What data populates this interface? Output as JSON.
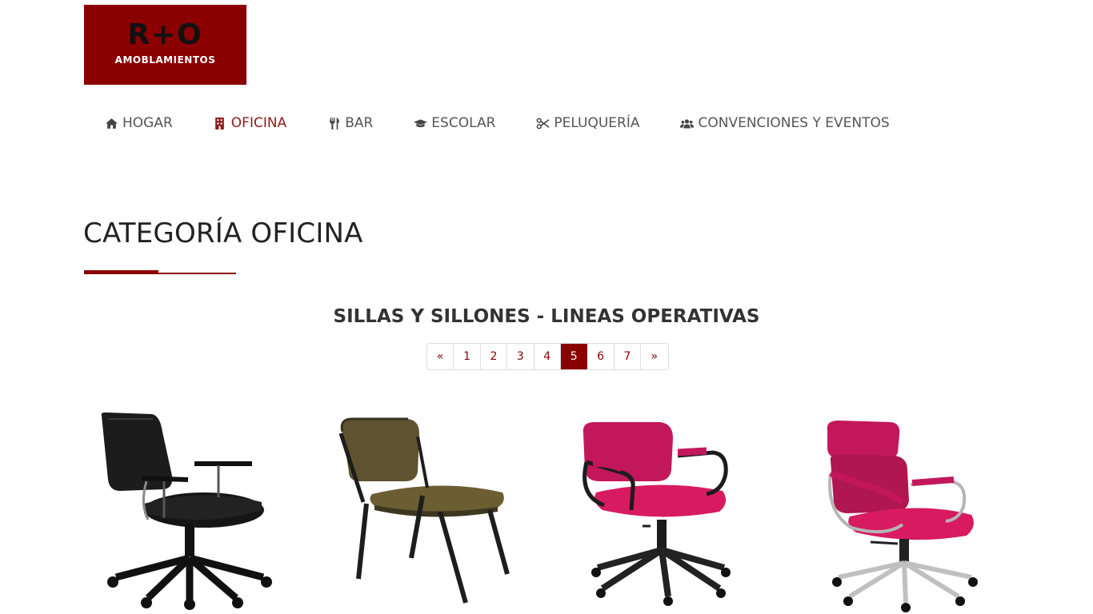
{
  "logo": {
    "main": "R+O",
    "sub": "AMOBLAMIENTOS"
  },
  "nav": {
    "items": [
      {
        "label": "HOGAR",
        "icon": "home-icon",
        "active": false
      },
      {
        "label": "OFICINA",
        "icon": "building-icon",
        "active": true
      },
      {
        "label": "BAR",
        "icon": "cutlery-icon",
        "active": false
      },
      {
        "label": "ESCOLAR",
        "icon": "graduation-cap-icon",
        "active": false
      },
      {
        "label": "PELUQUERÍA",
        "icon": "scissors-icon",
        "active": false
      },
      {
        "label": "CONVENCIONES Y EVENTOS",
        "icon": "users-icon",
        "active": false
      }
    ]
  },
  "page": {
    "title": "CATEGORÍA OFICINA",
    "section_title": "SILLAS Y SILLONES - LINEAS OPERATIVAS"
  },
  "pagination": {
    "prev": "«",
    "pages": [
      "1",
      "2",
      "3",
      "4",
      "5",
      "6",
      "7"
    ],
    "current": "5",
    "next": "»"
  },
  "products": [
    {
      "name": "black-operative-chair",
      "color": "#1a1a1a"
    },
    {
      "name": "olive-stacking-chair",
      "color": "#6b5e33"
    },
    {
      "name": "magenta-armchair",
      "color": "#c2185b"
    },
    {
      "name": "magenta-executive-chair",
      "color": "#c2185b"
    }
  ],
  "colors": {
    "brand": "#8b0000",
    "nav_text": "#555555"
  }
}
